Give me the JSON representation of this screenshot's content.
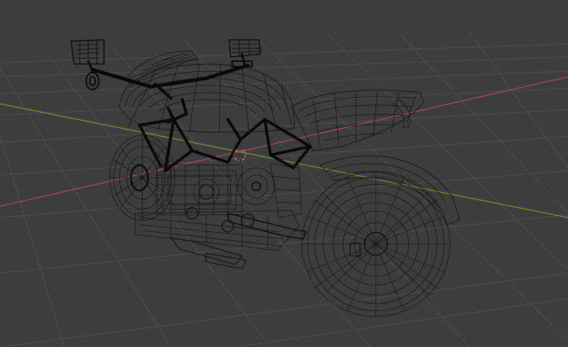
{
  "viewport": {
    "shading_mode": "wireframe",
    "background_color": "#3d3d3d",
    "grid_color": "#4f4f4f",
    "x_axis_color": "#b34a54",
    "y_axis_color": "#6f9a3a",
    "wire_color": "#141414",
    "frame_color": "#080808",
    "origin_color": "#c83232",
    "object": "motorcycle"
  }
}
